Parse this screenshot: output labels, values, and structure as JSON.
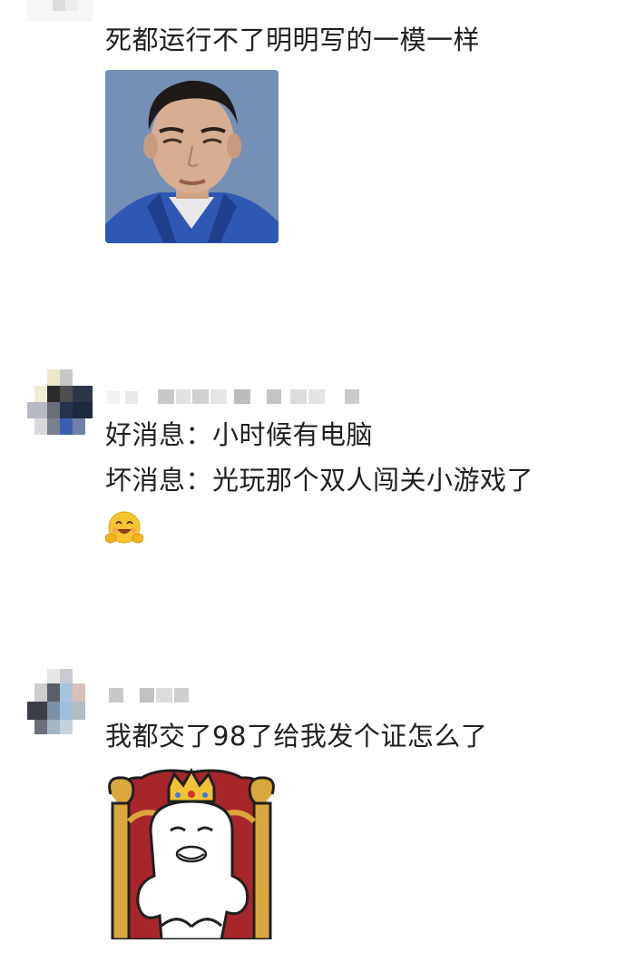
{
  "comments": [
    {
      "id": "c1",
      "lines": [
        "死都运行不了明明写的一模一样"
      ],
      "image": "student-id-photo"
    },
    {
      "id": "c2",
      "lines": [
        "好消息：小时候有电脑",
        "坏消息：光玩那个双人闯关小游戏了"
      ],
      "emoji": "smiling-hug-emoji"
    },
    {
      "id": "c3",
      "lines": [
        "我都交了98了给我发个证怎么了"
      ],
      "image": "king-throne-meme"
    }
  ]
}
